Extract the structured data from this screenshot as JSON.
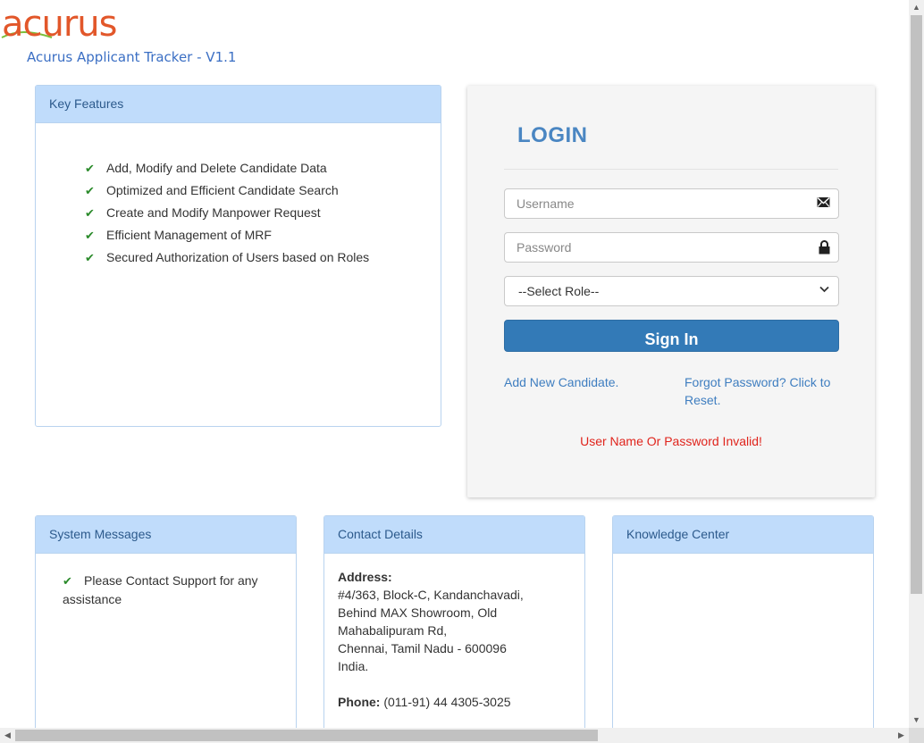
{
  "brand": {
    "logo_text": "acurus",
    "subtitle": "Acurus Applicant Tracker - V1.1",
    "logo_color": "#e2572a",
    "swoosh_color": "#7bbf3a"
  },
  "key_features": {
    "title": "Key Features",
    "items": [
      {
        "label": "Add, Modify and Delete Candidate Data",
        "icon": "check-icon"
      },
      {
        "label": "Optimized and Efficient Candidate Search",
        "icon": "check-icon"
      },
      {
        "label": "Create and Modify Manpower Request",
        "icon": "check-icon"
      },
      {
        "label": "Efficient Management of MRF",
        "icon": "check-icon"
      },
      {
        "label": "Secured Authorization of Users based on Roles",
        "icon": "check-icon"
      }
    ]
  },
  "login": {
    "title": "LOGIN",
    "username": {
      "placeholder": "Username",
      "value": "",
      "icon": "envelope-icon"
    },
    "password": {
      "placeholder": "Password",
      "value": "",
      "icon": "lock-icon"
    },
    "role": {
      "selected": "--Select Role--",
      "icon": "chevron-down-icon"
    },
    "sign_in_label": "Sign In",
    "add_candidate_link": "Add New Candidate.",
    "forgot_password_link": "Forgot Password? Click to Reset.",
    "error_message": "User Name Or Password Invalid!",
    "error_color": "#e0241c",
    "button_color": "#337ab7"
  },
  "system_messages": {
    "title": "System Messages",
    "message": "Please Contact Support for any assistance",
    "icon": "check-icon"
  },
  "contact": {
    "title": "Contact Details",
    "address_label": "Address:",
    "address_lines": [
      "#4/363, Block-C, Kandanchavadi,",
      "Behind MAX Showroom, Old",
      "Mahabalipuram Rd,",
      "Chennai, Tamil Nadu - 600096",
      "India."
    ],
    "phone_label": "Phone:",
    "phone": "(011-91) 44 4305-3025"
  },
  "knowledge_center": {
    "title": "Knowledge Center"
  },
  "colors": {
    "panel_heading_bg": "#c0dcfb",
    "check_green": "#2a8a2a",
    "link_blue": "#3f7ec0"
  }
}
